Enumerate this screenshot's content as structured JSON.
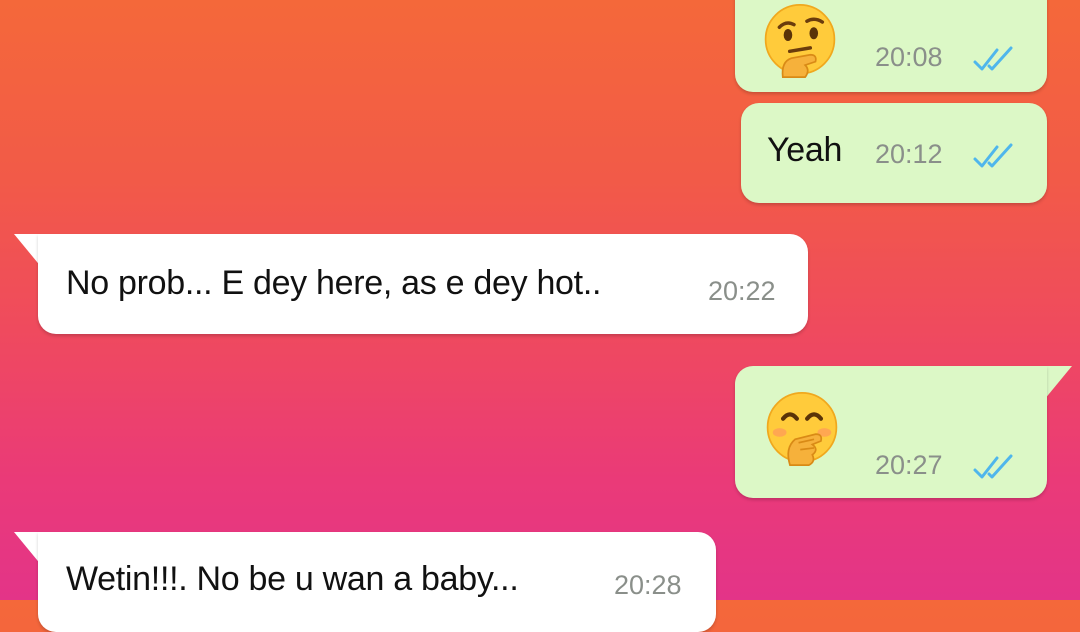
{
  "messages": [
    {
      "direction": "outgoing",
      "content_type": "emoji",
      "emoji": "thinking-face-icon",
      "time": "20:08",
      "status": "read"
    },
    {
      "direction": "outgoing",
      "content_type": "text",
      "text": "Yeah",
      "time": "20:12",
      "status": "read"
    },
    {
      "direction": "incoming",
      "content_type": "text",
      "text": "No prob... E dey here, as e dey hot..",
      "time": "20:22"
    },
    {
      "direction": "outgoing",
      "content_type": "emoji",
      "emoji": "face-with-hand-over-mouth-icon",
      "time": "20:27",
      "status": "read"
    },
    {
      "direction": "incoming",
      "content_type": "text",
      "text": "Wetin!!!. No be u wan a baby...",
      "time": "20:28"
    }
  ],
  "colors": {
    "outgoing_bubble": "#dcf8c6",
    "incoming_bubble": "#ffffff",
    "read_ticks": "#4fb6ec",
    "timestamp": "#8a8f8a"
  }
}
